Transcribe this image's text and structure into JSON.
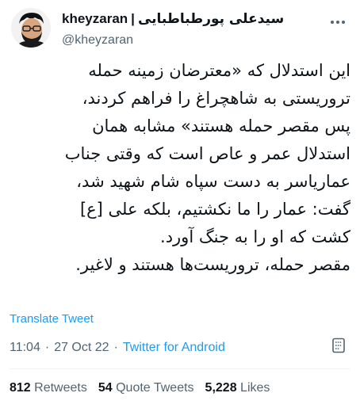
{
  "author": {
    "display_name_latin": "kheyzaran",
    "separator": "|",
    "display_name_persian": "سیدعلی پورطباطبایی",
    "handle": "@kheyzaran"
  },
  "tweet": {
    "lines": [
      "این استدلال که «معترضان زمینه حمله",
      "تروریستی به شاهچراغ را فراهم کردند،",
      "پس مقصر حمله هستند» مشابه همان",
      "استدلال عمر و عاص است که وقتی جناب",
      "عماریاسر به دست سپاه شام شهید شد،",
      "گفت: عمار را ما نکشتیم، بلکه علی [ع]",
      "کشت که او را به جنگ آورد.",
      "مقصر حمله، تروریست‌ها هستند و لاغیر."
    ],
    "translate_label": "Translate Tweet"
  },
  "meta": {
    "time": "11:04",
    "date": "27 Oct 22",
    "dot": "·",
    "source": "Twitter for Android"
  },
  "stats": {
    "retweets_count": "812",
    "retweets_label": "Retweets",
    "quotes_count": "54",
    "quotes_label": "Quote Tweets",
    "likes_count": "5,228",
    "likes_label": "Likes"
  },
  "icons": {
    "avatar": "avatar-illustration",
    "more": "more-options-icon",
    "analytics": "analytics-icon"
  },
  "colors": {
    "link": "#1d9bf0",
    "secondary_text": "#536471",
    "primary_text": "#0f1419",
    "divider": "#eff3f4"
  }
}
